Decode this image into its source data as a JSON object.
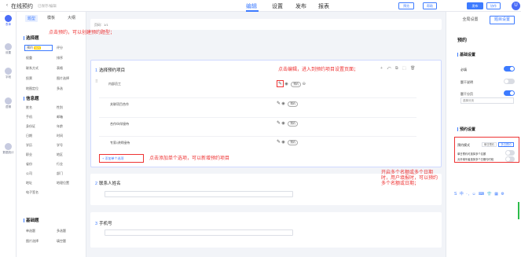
{
  "header": {
    "back_icon": "back-arrow-icon",
    "title": "在线预约",
    "status": "已保存/编辑",
    "nav": [
      "编辑",
      "设置",
      "发布",
      "报表"
    ],
    "btn_a": "预览",
    "btn_b": "帮助",
    "btn_publish": "发布",
    "btn_d": "协作",
    "avatar": "U"
  },
  "rail": [
    "表单",
    "设置",
    "字段",
    "逻辑",
    "数据统计"
  ],
  "widgets": {
    "tabs": [
      "题型",
      "模板",
      "大纲"
    ],
    "groups": [
      "选择题",
      "信息题",
      "基础题"
    ],
    "choice_items": [
      "预约",
      "评分",
      "权重",
      "排序",
      "联系方式",
      "表格",
      "投票",
      "图片选择",
      "地图定位",
      "多选"
    ],
    "info_items": [
      "姓名",
      "性别",
      "手机",
      "邮箱",
      "身份证",
      "年龄",
      "日期",
      "时间",
      "学历",
      "学号",
      "职业",
      "地区",
      "省份",
      "行业",
      "公司",
      "部门",
      "地址",
      "地理位置",
      "电子签名"
    ],
    "base_items": [
      "单选题",
      "多选题",
      "图片选择",
      "填空题"
    ],
    "new_tag": "NEW"
  },
  "canvas": {
    "pageinfo": "页码：1/1",
    "q1_num": "1",
    "q1_title": "选择预约项目",
    "options": [
      "内部员工",
      "关联项目合作",
      "合作伙伴接待",
      "专家/讲师接待"
    ],
    "option_pill": "预约",
    "add_option": "添加单个选项",
    "q2_num": "2",
    "q2_title": "联系人姓名",
    "q3_num": "3",
    "q3_title": "手机号",
    "card_tools": "+ ⤺ ⧉ ⬚ 🗑"
  },
  "annotations": {
    "a1": "点击预约，可以创建预约题型；",
    "a2": "点击编辑，进入到预约项目设置页面；",
    "a3": "点击添加单个选项，可以新增预约项目",
    "a4": "开启多个名额或多个日期时，用户填报时，可以预约多个名额或日期；"
  },
  "settings": {
    "tabs": [
      "全局设置",
      "题目设置"
    ],
    "heading": "预约",
    "group1": "基础设置",
    "rows": [
      "必填",
      "题干说明",
      "题干分页"
    ],
    "select_placeholder": "选择分页",
    "group2": "预约设置",
    "mode_label": "预约模式",
    "mode_options": [
      "单日预约",
      "多日预约"
    ],
    "row_multi_qty": "单日预约可选择多个名额",
    "row_multi_date": "允许填写者选择多个日期与时段",
    "ime_bar": "S 中 ·, ☺ ⌨ 👕 ▦ ⚙"
  },
  "colors": {
    "accent": "#3d7bff",
    "annotation_red": "#ee3333"
  }
}
